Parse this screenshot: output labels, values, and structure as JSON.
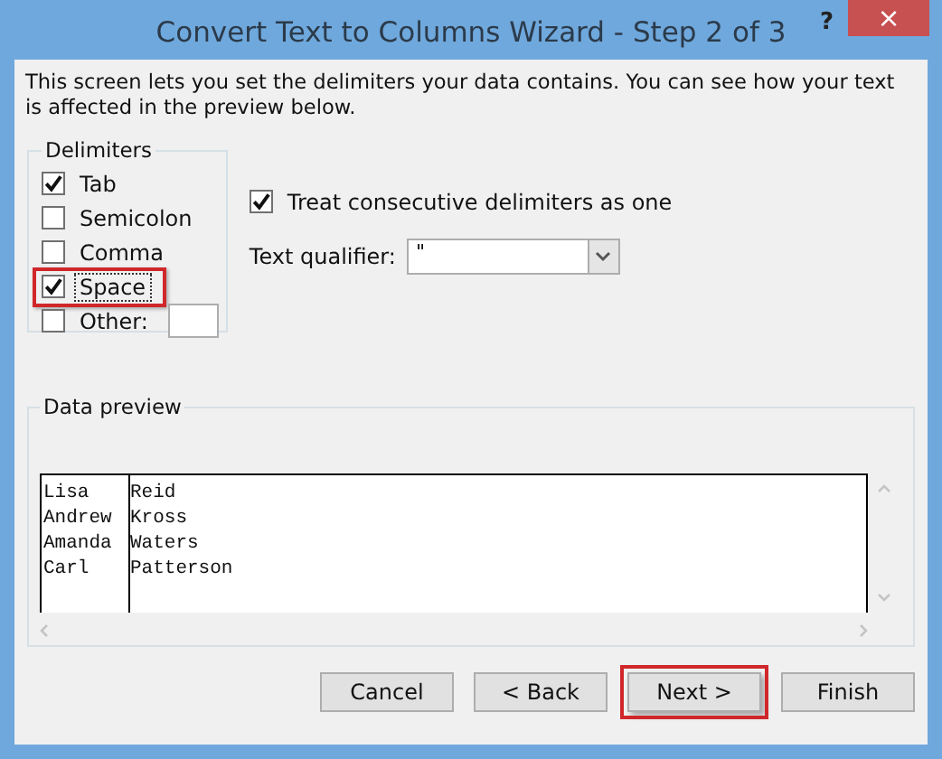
{
  "window": {
    "title": "Convert Text to Columns Wizard - Step 2 of 3",
    "help": "?",
    "close": "×"
  },
  "description": "This screen lets you set the delimiters your data contains.  You can see how your text is affected in the preview below.",
  "delimiters": {
    "title": "Delimiters",
    "items": [
      {
        "label": "Tab",
        "checked": true,
        "highlighted": false
      },
      {
        "label": "Semicolon",
        "checked": false,
        "highlighted": false
      },
      {
        "label": "Comma",
        "checked": false,
        "highlighted": false
      },
      {
        "label": "Space",
        "checked": true,
        "highlighted": true
      },
      {
        "label": "Other:",
        "checked": false,
        "highlighted": false,
        "kind": "other"
      }
    ]
  },
  "consecutive": {
    "label": "Treat consecutive delimiters as one",
    "checked": true
  },
  "qualifier": {
    "label": "Text qualifier:",
    "value": "\""
  },
  "preview": {
    "title": "Data preview",
    "rows": [
      [
        "Lisa",
        "Reid"
      ],
      [
        "Andrew",
        "Kross"
      ],
      [
        "Amanda",
        "Waters"
      ],
      [
        "Carl",
        "Patterson"
      ]
    ]
  },
  "buttons": [
    {
      "label": "Cancel",
      "highlighted": false
    },
    {
      "label": "< Back",
      "highlighted": false
    },
    {
      "label": "Next >",
      "highlighted": true
    },
    {
      "label": "Finish",
      "highlighted": false
    }
  ]
}
